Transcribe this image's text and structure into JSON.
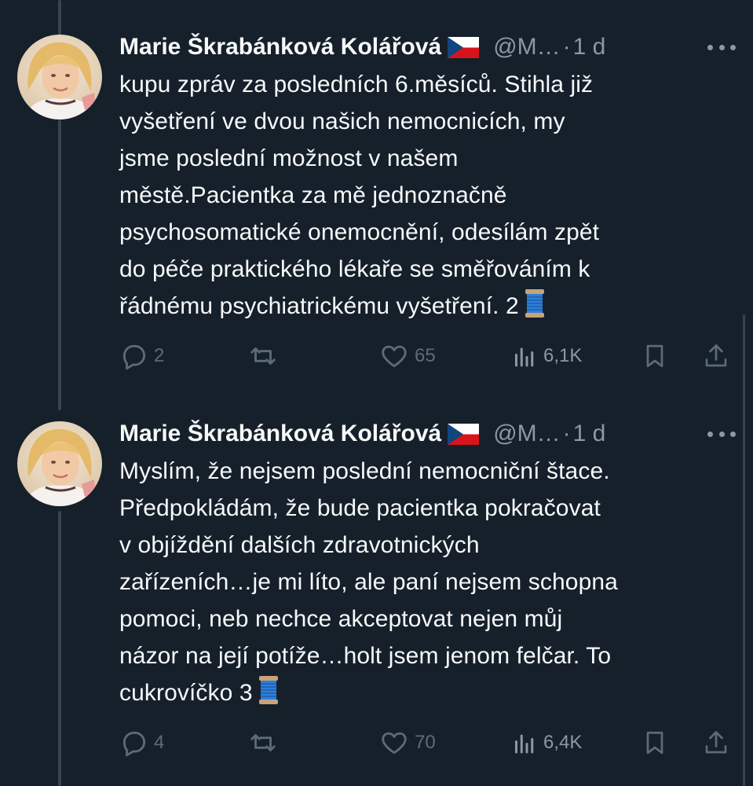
{
  "tweets": [
    {
      "author_name": "Marie Škrabánková Kolářová",
      "handle": "@M…",
      "separator": "·",
      "time": "1 d",
      "text": "kupu zpráv za posledních 6.měsíců. Stihla již vyšetření ve dvou našich nemocnicích, my jsme poslední možnost v našem městě.Pacientka za mě jednoznačně psychosomatické onemocnění, odesílám zpět do péče praktického lékaře se směřováním k řádnému psychiatrickému vyšetření. 2",
      "lines": [
        "kupu zpráv za posledních 6.měsíců. Stihla již",
        "vyšetření ve dvou našich nemocnicích, my",
        "jsme poslední možnost v našem",
        "městě.Pacientka za mě jednoznačně",
        "psychosomatické onemocnění, odesílám zpět",
        "do péče praktického lékaře se směřováním k",
        "řádnému psychiatrickému vyšetření. 2"
      ],
      "emoji": "thread-spool-icon",
      "replies": "2",
      "retweets": "",
      "likes": "65",
      "views": "6,1K"
    },
    {
      "author_name": "Marie Škrabánková Kolářová",
      "handle": "@M…",
      "separator": "·",
      "time": "1 d",
      "text": "Myslím, že nejsem poslední nemocniční štace. Předpokládám, že bude pacientka pokračovat v objíždění dalších zdravotnických zařízeních…je mi líto, ale paní nejsem schopna pomoci, neb nechce akceptovat nejen můj názor na její potíže…holt jsem jenom felčar. To cukrovíčko 3",
      "lines": [
        "Myslím, že nejsem poslední nemocniční štace.",
        "Předpokládám, že bude pacientka pokračovat",
        "v objíždění dalších zdravotnických",
        "zařízeních…je mi líto, ale paní nejsem schopna",
        "pomoci, neb nechce akceptovat nejen můj",
        "názor na její potíže…holt jsem jenom felčar. To",
        "cukrovíčko 3"
      ],
      "emoji": "thread-spool-icon",
      "replies": "4",
      "retweets": "",
      "likes": "70",
      "views": "6,4K"
    }
  ],
  "colors": {
    "background": "#15202b",
    "text": "#f7f9f9",
    "muted": "#8b98a5",
    "action_icon": "#5b6b77",
    "thread_line": "#38444d"
  }
}
